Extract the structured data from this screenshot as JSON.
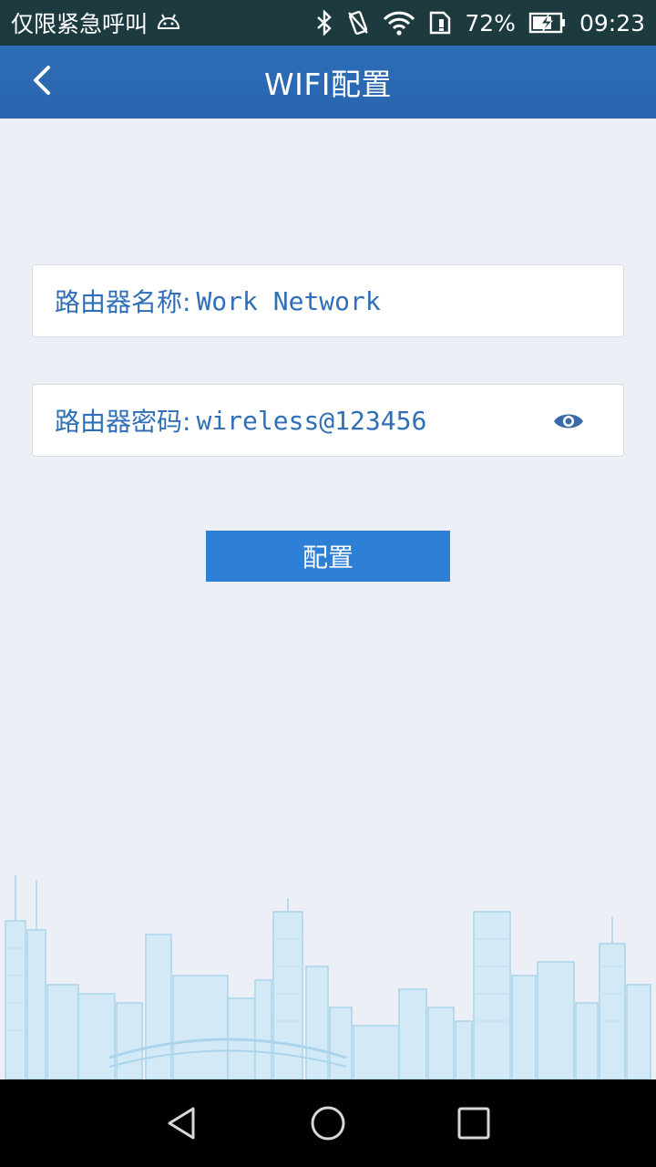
{
  "status_bar": {
    "emergency_text": "仅限紧急呼叫",
    "battery_percent": "72%",
    "time": "09:23",
    "icons": [
      "android-icon",
      "bluetooth-icon",
      "vibrate-icon",
      "wifi-icon",
      "sim-icon",
      "battery-charging-icon"
    ]
  },
  "header": {
    "title": "WIFI配置",
    "back_icon": "chevron-left-icon",
    "color": "#2d6db8"
  },
  "form": {
    "router_name": {
      "label": "路由器名称:",
      "value": "Work Network"
    },
    "router_password": {
      "label": "路由器密码:",
      "value": "wireless@123456",
      "toggle_icon": "eye-icon"
    },
    "submit_label": "配置",
    "accent_color": "#2e7fd6"
  },
  "nav_bar": {
    "icons": [
      "back-triangle-icon",
      "home-circle-icon",
      "recents-square-icon"
    ]
  }
}
